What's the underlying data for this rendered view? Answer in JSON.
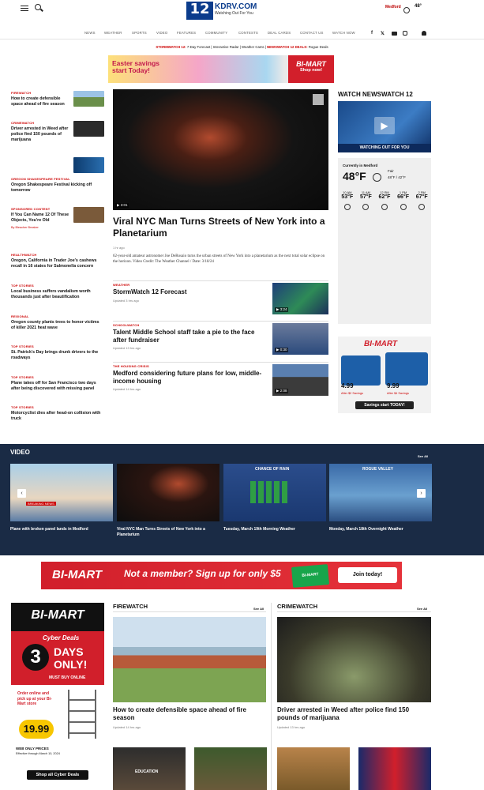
{
  "header": {
    "logo_channel": "12",
    "logo_site": "KDRV.COM",
    "logo_tagline": "Watching Out For You",
    "location": "Medford",
    "temperature": "48°"
  },
  "nav": [
    "NEWS",
    "WEATHER",
    "SPORTS",
    "VIDEO",
    "FEATURES",
    "COMMUNITY",
    "CONTESTS",
    "DEAL CARDS",
    "CONTACT US",
    "WATCH NOW"
  ],
  "social_icons": [
    "facebook-icon",
    "x-icon",
    "youtube-icon",
    "instagram-icon",
    "user-icon"
  ],
  "subnav": {
    "stormwatch_label": "STORMWATCH 12:",
    "stormwatch_links": [
      "7-Day Forecast",
      "Interactive Radar",
      "Weather Cams"
    ],
    "deals_label": "NEWSWATCH 12 DEALS:",
    "deals_link": "Rogue Deals"
  },
  "top_ad": {
    "line1": "Easter savings",
    "line2": "start Today!",
    "brand": "BI-MART",
    "cta": "Shop now!"
  },
  "sidebar": [
    {
      "kicker": "FIREWATCH",
      "title": "How to create defensible space ahead of fire season",
      "has_thumb": true
    },
    {
      "kicker": "CRIMEWATCH",
      "title": "Driver arrested in Weed after police find 150 pounds of marijuana",
      "has_thumb": true
    },
    {
      "kicker": "OREGON SHAKESPEARE FESTIVAL",
      "title": "Oregon Shakespeare Festival kicking off tomorrow",
      "has_thumb": true
    },
    {
      "kicker": "SPONSORED CONTENT",
      "title": "If You Can Name 12 Of These Objects, You're Old",
      "sponsor": "By Bleacher Breaker",
      "has_thumb": true
    },
    {
      "kicker": "HEALTHWATCH",
      "title": "Oregon, California in Trader Joe's cashews recall in 16 states for Salmonella concern"
    },
    {
      "kicker": "TOP STORIES",
      "title": "Local business suffers vandalism worth thousands just after beautification"
    },
    {
      "kicker": "REGIONAL",
      "title": "Oregon county plants trees to honor victims of killer 2021 heat wave"
    },
    {
      "kicker": "TOP STORIES",
      "title": "St. Patrick's Day brings drunk drivers to the roadways"
    },
    {
      "kicker": "TOP STORIES",
      "title": "Plane takes off for San Francisco two days after being discovered with missing panel"
    },
    {
      "kicker": "TOP STORIES",
      "title": "Motorcyclist dies after head-on collision with truck"
    }
  ],
  "hero": {
    "duration": "3:01",
    "title": "Viral NYC Man Turns Streets of New York into a Planetarium",
    "date": "1 hr ago",
    "description": "62-year-old amateur astronomer Joe DeRosaio turns the urban streets of New York into a planetarium as the next total solar eclipse on the horizon. Video Credit: The Weather Channel / Date: 3/18/24"
  },
  "stories": [
    {
      "kicker": "WEATHER",
      "title": "StormWatch 12 Forecast",
      "date": "Updated 3 hrs ago",
      "duration": "3:24"
    },
    {
      "kicker": "SCHOOLWATCH",
      "title": "Talent Middle School staff take a pie to the face after fundraiser",
      "date": "Updated 13 hrs ago",
      "duration": "0:30"
    },
    {
      "kicker": "THE HOUSING CRISIS",
      "title": "Medford considering future plans for low, middle-income housing",
      "date": "Updated 14 hrs ago",
      "duration": "2:08"
    }
  ],
  "right_rail": {
    "watch_heading": "WATCH NEWSWATCH 12",
    "video_label": "WATCHING OUT FOR YOU",
    "weather": {
      "location_label": "Currently in Medford",
      "temp": "48°F",
      "condition": "Fair",
      "hi_lo": "48°F / 42°F",
      "hours": [
        {
          "time": "10 AM",
          "temp": "53°F"
        },
        {
          "time": "11 AM",
          "temp": "57°F"
        },
        {
          "time": "12 PM",
          "temp": "62°F"
        },
        {
          "time": "1 PM",
          "temp": "66°F"
        },
        {
          "time": "2 PM",
          "temp": "67°F"
        }
      ]
    },
    "ad": {
      "brand": "BI-MART",
      "price1": "4.99",
      "price1_note": "After $2 Savings",
      "price2": "9.99",
      "price2_note": "After $4 Savings",
      "cta": "Savings start TODAY!"
    }
  },
  "video_section": {
    "heading": "VIDEO",
    "see_all": "See All",
    "items": [
      {
        "caption": "Plane with broken panel lands in Medford",
        "overlay": "BREAKING NEWS"
      },
      {
        "caption": "Viral NYC Man Turns Streets of New York into a Planetarium"
      },
      {
        "caption": "Tuesday, March 19th Morning Weather",
        "overlay": "CHANCE OF RAIN"
      },
      {
        "caption": "Monday, March 18th Overnight Weather",
        "overlay": "ROGUE VALLEY"
      }
    ]
  },
  "member_banner": {
    "brand": "BI-MART",
    "tagline": "Not a member? Sign up for only $5",
    "card_text": "BI-MART",
    "cta": "Join today!"
  },
  "square_ad": {
    "brand": "BI-MART",
    "headline": "Cyber Deals",
    "big_number": "3",
    "days": "DAYS",
    "only": "ONLY!",
    "must": "MUST BUY ONLINE",
    "pickup": "Order online and pick up at your Bi-Mart store",
    "price": "19.99",
    "web_only": "WEB ONLY PRICES",
    "effective": "Effective through March 10, 2024",
    "cta": "Shop all Cyber Deals"
  },
  "firewatch": {
    "heading": "FIREWATCH",
    "see_all": "See All",
    "title": "How to create defensible space ahead of fire season",
    "date": "Updated 14 hrs ago",
    "thumb2_label": "EDUCATION"
  },
  "crimewatch": {
    "heading": "CRIMEWATCH",
    "see_all": "See All",
    "title": "Driver arrested in Weed after police find 150 pounds of marijuana",
    "date": "Updated 13 hrs ago"
  }
}
